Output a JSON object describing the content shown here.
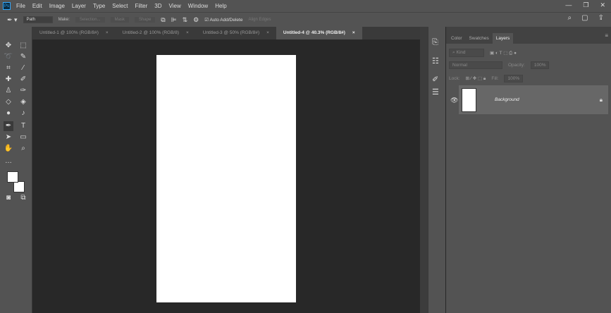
{
  "app": {
    "logo": "Ps",
    "menu": [
      "File",
      "Edit",
      "Image",
      "Layer",
      "Type",
      "Select",
      "Filter",
      "3D",
      "View",
      "Window",
      "Help"
    ]
  },
  "options": {
    "mode": "Path",
    "make_label": "Make:",
    "selection": "Selection...",
    "mask": "Mask",
    "shape": "Shape",
    "auto_add": "Auto Add/Delete",
    "align_edges": "Align Edges"
  },
  "tabs": [
    {
      "label": "Untitled-1 @ 100% (RGB/8#)"
    },
    {
      "label": "Untitled-2 @ 100% (RGB/8)"
    },
    {
      "label": "Untitled-3 @ 50% (RGB/8#)"
    },
    {
      "label": "Untitled-4 @ 40.3% (RGB/8#)",
      "active": true
    }
  ],
  "panel": {
    "tabs": [
      "Color",
      "Swatches",
      "Layers"
    ],
    "kind": "Kind",
    "blend": "Normal",
    "opacity_label": "Opacity:",
    "opacity": "100%",
    "lock_label": "Lock:",
    "fill_label": "Fill:",
    "fill": "100%"
  },
  "layers": [
    {
      "name": "Background",
      "locked": true
    }
  ]
}
